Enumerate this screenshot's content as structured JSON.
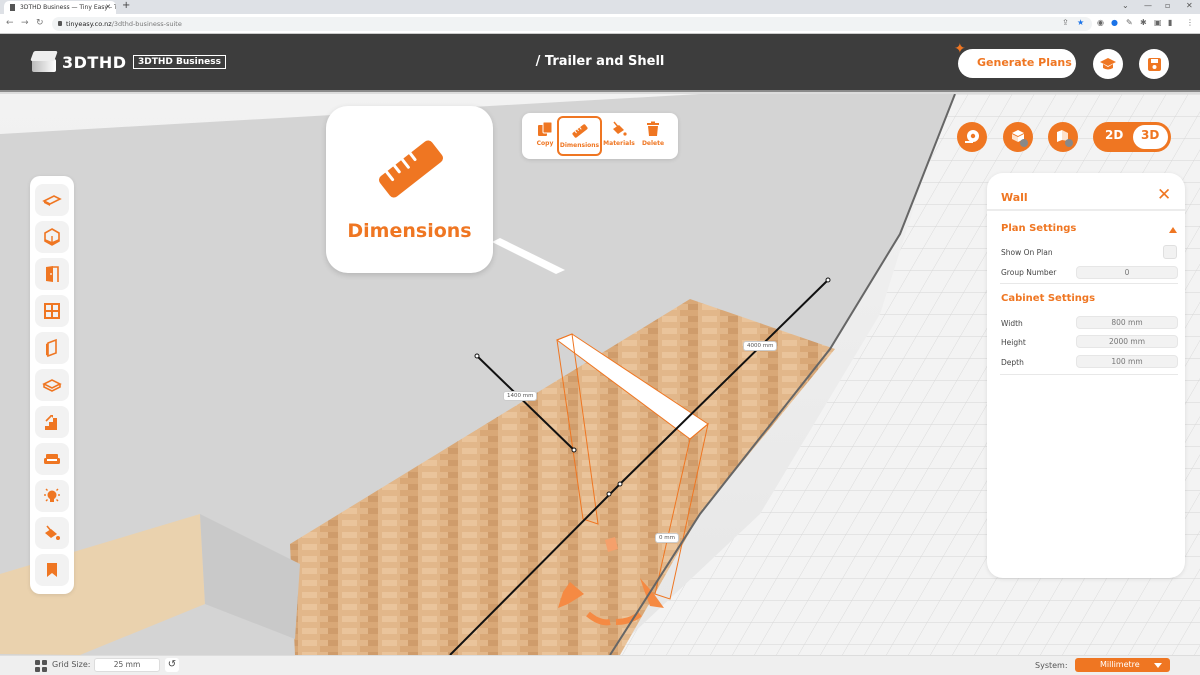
{
  "browser": {
    "tab_title": "3DTHD Business — Tiny Easy - Ti",
    "url_domain": "tinyeasy.co.nz",
    "url_path": "/3dthd-business-suite"
  },
  "header": {
    "logo_text": "3DTHD",
    "business_badge": "3DTHD Business",
    "title": "/ Trailer and Shell",
    "generate_plans_label": "Generate Plans",
    "tutorial_icon": "graduation-cap-icon",
    "save_icon": "save-icon"
  },
  "tool_preview": {
    "label": "Dimensions",
    "icon": "ruler-icon"
  },
  "context_toolbar": {
    "items": [
      {
        "label": "Copy",
        "icon": "copy-icon",
        "active": false
      },
      {
        "label": "Dimensions",
        "icon": "ruler-icon",
        "active": true
      },
      {
        "label": "Materials",
        "icon": "paint-bucket-icon",
        "active": false
      },
      {
        "label": "Delete",
        "icon": "trash-icon",
        "active": false
      }
    ]
  },
  "view_controls": {
    "buttons": [
      "tape-measure-icon",
      "show-walls-icon",
      "hide-walls-icon"
    ],
    "toggle": {
      "option_2d": "2D",
      "option_3d": "3D",
      "selected": "3D"
    }
  },
  "side_toolbar": {
    "items": [
      "floor-icon",
      "shell-icon",
      "door-icon",
      "window-icon",
      "wall-panel-icon",
      "platform-icon",
      "stairs-icon",
      "furniture-icon",
      "lighting-icon",
      "materials-icon",
      "bookmark-icon"
    ]
  },
  "properties_panel": {
    "title": "Wall",
    "plan_settings": {
      "title": "Plan Settings",
      "show_on_plan_label": "Show On Plan",
      "show_on_plan_checked": false,
      "group_number_label": "Group Number",
      "group_number_value": "0"
    },
    "cabinet_settings": {
      "title": "Cabinet Settings",
      "width_label": "Width",
      "width_value": "800 mm",
      "height_label": "Height",
      "height_value": "2000 mm",
      "depth_label": "Depth",
      "depth_value": "100 mm"
    }
  },
  "scene": {
    "dimension_labels": [
      "1400 mm",
      "4000 mm",
      "0 mm"
    ]
  },
  "status_bar": {
    "grid_size_label": "Grid Size:",
    "grid_size_value": "25 mm",
    "system_label": "System:",
    "system_value": "Millimetre"
  },
  "colors": {
    "accent": "#ef7622",
    "header_bg": "#3d3d3d"
  }
}
